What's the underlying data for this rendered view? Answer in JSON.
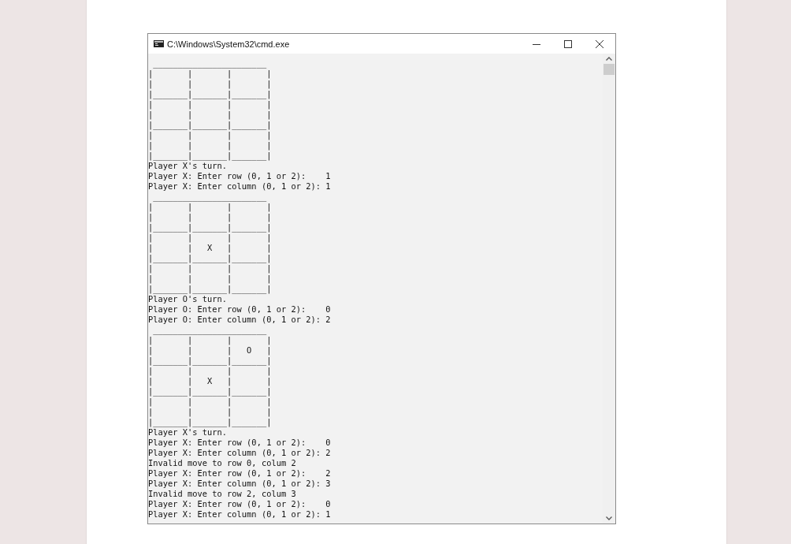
{
  "window": {
    "title": "C:\\Windows\\System32\\cmd.exe"
  },
  "console": {
    "lines": [
      " _______________________",
      "|       |       |       |",
      "|       |       |       |",
      "|_______|_______|_______|",
      "|       |       |       |",
      "|       |       |       |",
      "|_______|_______|_______|",
      "|       |       |       |",
      "|       |       |       |",
      "|_______|_______|_______|",
      "Player X's turn.",
      "Player X: Enter row (0, 1 or 2):    1",
      "Player X: Enter column (0, 1 or 2): 1",
      " _______________________",
      "|       |       |       |",
      "|       |       |       |",
      "|_______|_______|_______|",
      "|       |       |       |",
      "|       |   X   |       |",
      "|_______|_______|_______|",
      "|       |       |       |",
      "|       |       |       |",
      "|_______|_______|_______|",
      "Player O's turn.",
      "Player O: Enter row (0, 1 or 2):    0",
      "Player O: Enter column (0, 1 or 2): 2",
      " _______________________",
      "|       |       |       |",
      "|       |       |   O   |",
      "|_______|_______|_______|",
      "|       |       |       |",
      "|       |   X   |       |",
      "|_______|_______|_______|",
      "|       |       |       |",
      "|       |       |       |",
      "|_______|_______|_______|",
      "Player X's turn.",
      "Player X: Enter row (0, 1 or 2):    0",
      "Player X: Enter column (0, 1 or 2): 2",
      "Invalid move to row 0, colum 2",
      "Player X: Enter row (0, 1 or 2):    2",
      "Player X: Enter column (0, 1 or 2): 3",
      "Invalid move to row 2, colum 3",
      "Player X: Enter row (0, 1 or 2):    0",
      "Player X: Enter column (0, 1 or 2): 1"
    ]
  }
}
